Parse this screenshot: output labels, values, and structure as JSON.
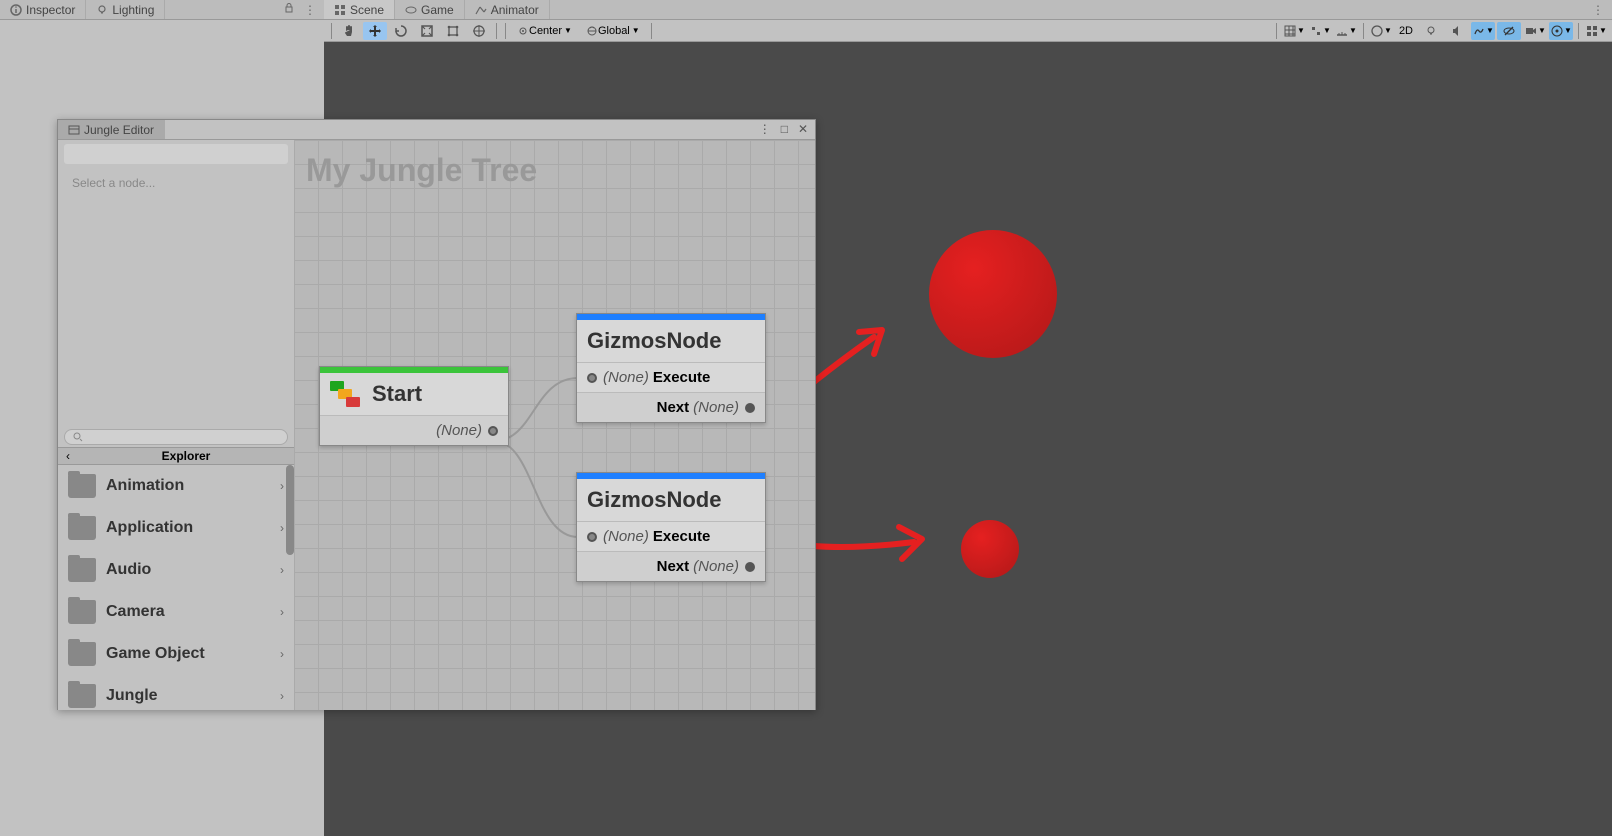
{
  "topTabs": {
    "left": [
      {
        "label": "Inspector"
      },
      {
        "label": "Lighting"
      }
    ],
    "right": [
      {
        "label": "Scene"
      },
      {
        "label": "Game"
      },
      {
        "label": "Animator"
      }
    ]
  },
  "sceneToolbar": {
    "pivot": "Center",
    "handle": "Global",
    "mode2d": "2D"
  },
  "jungle": {
    "tab": "Jungle Editor",
    "placeholder": "Select a node...",
    "explorerHeader": "Explorer",
    "folders": [
      {
        "label": "Animation"
      },
      {
        "label": "Application"
      },
      {
        "label": "Audio"
      },
      {
        "label": "Camera"
      },
      {
        "label": "Game Object"
      },
      {
        "label": "Jungle"
      }
    ],
    "canvasTitle": "My Jungle Tree"
  },
  "nodes": {
    "start": {
      "title": "Start",
      "outLabel": "(None)"
    },
    "gizmos1": {
      "title": "GizmosNode",
      "inNone": "(None)",
      "inLabel": "Execute",
      "outLabel": "Next",
      "outNone": "(None)"
    },
    "gizmos2": {
      "title": "GizmosNode",
      "inNone": "(None)",
      "inLabel": "Execute",
      "outLabel": "Next",
      "outNone": "(None)"
    }
  }
}
